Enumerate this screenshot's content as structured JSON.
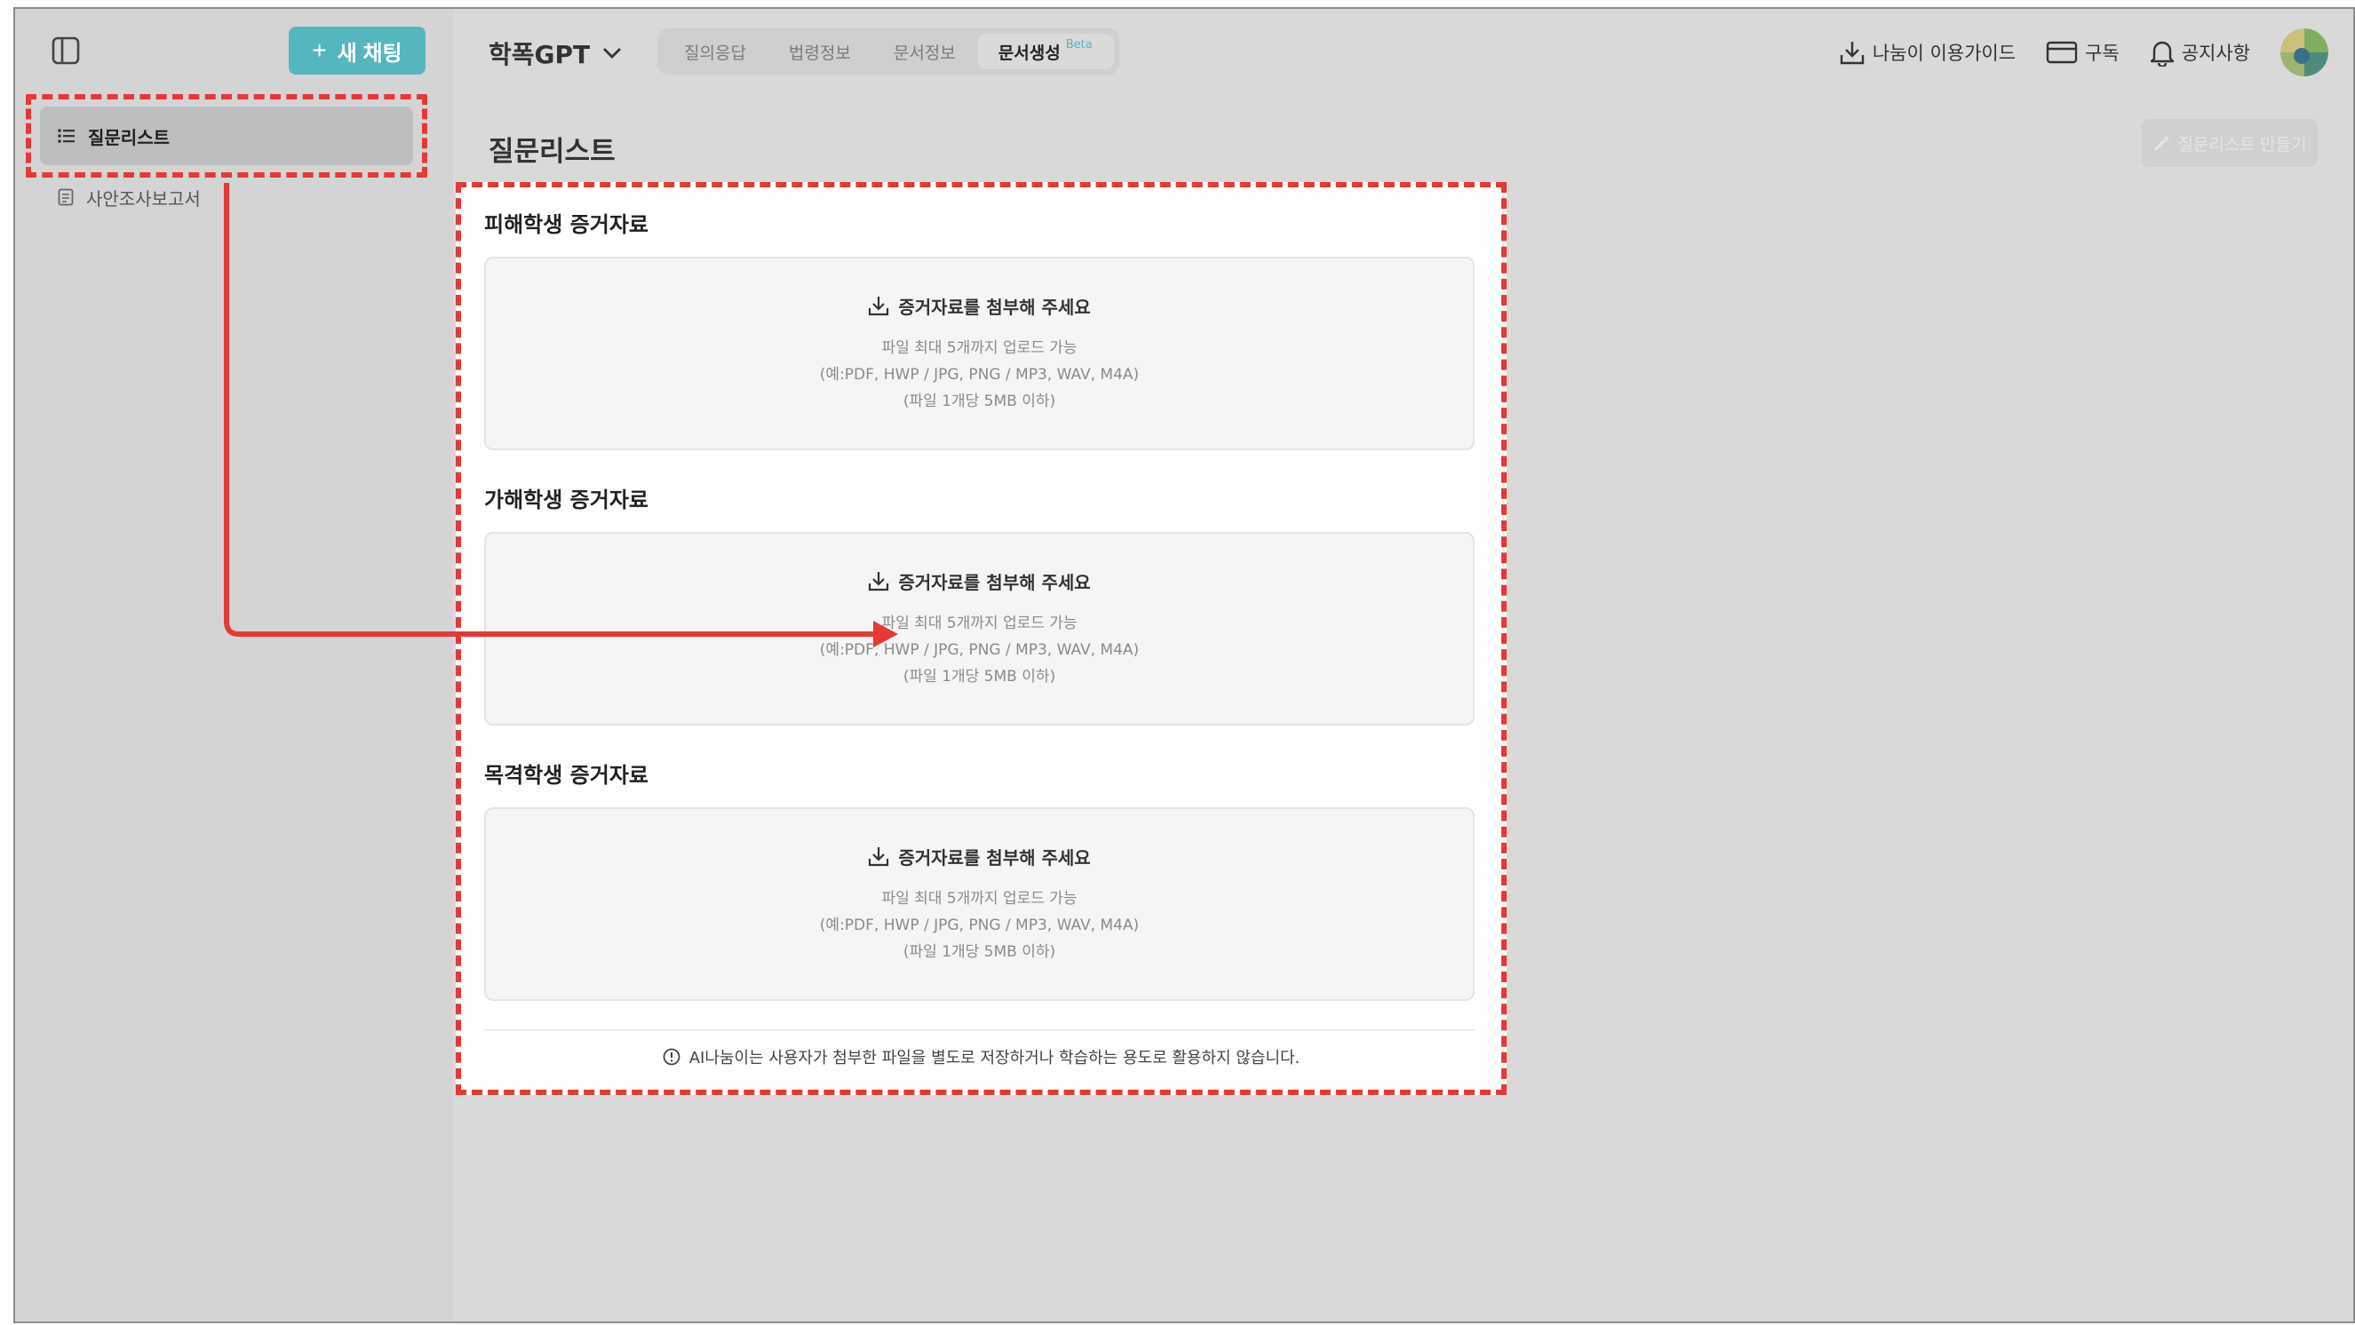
{
  "sidebar": {
    "new_chat_label": "새 채팅",
    "items": [
      {
        "label": "질문리스트",
        "icon": "list-icon",
        "active": true
      },
      {
        "label": "사안조사보고서",
        "icon": "document-icon",
        "active": false
      }
    ]
  },
  "header": {
    "brand": "학폭GPT",
    "tabs": [
      {
        "label": "질의응답"
      },
      {
        "label": "법령정보"
      },
      {
        "label": "문서정보"
      },
      {
        "label": "문서생성",
        "badge": "Beta"
      }
    ],
    "links": {
      "guide": "나눔이 이용가이드",
      "subscribe": "구독",
      "notice": "공지사항"
    }
  },
  "page": {
    "title": "질문리스트",
    "make_button": "질문리스트 만들기"
  },
  "evidence": {
    "sections": [
      {
        "title": "피해학생 증거자료"
      },
      {
        "title": "가해학생 증거자료"
      },
      {
        "title": "목격학생 증거자료"
      }
    ],
    "dropzone": {
      "heading": "증거자료를 첨부해 주세요",
      "line1": "파일 최대 5개까지 업로드 가능",
      "line2": "(예:PDF, HWP / JPG, PNG / MP3, WAV, M4A)",
      "line3": "(파일 1개당 5MB 이하)"
    },
    "notice": "AI나눔이는 사용자가 첨부한 파일을 별도로 저장하거나 학습하는 용도로 활용하지 않습니다."
  },
  "colors": {
    "accent": "#56b6bd",
    "highlight": "#e53935",
    "overlay": "#d9d9d9"
  }
}
